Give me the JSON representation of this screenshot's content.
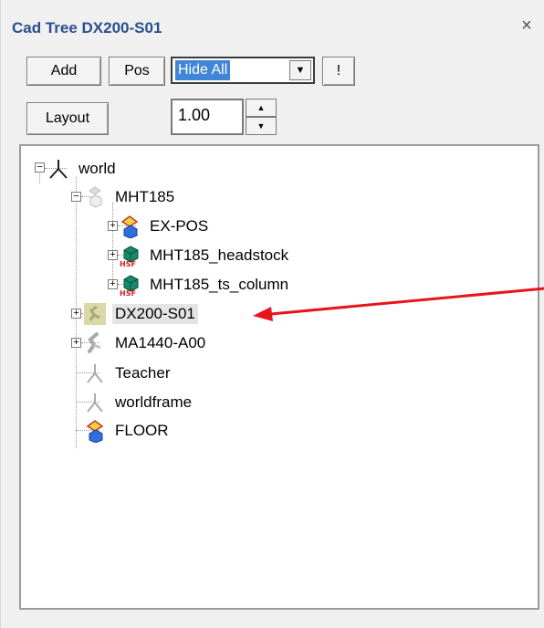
{
  "panel": {
    "title": "Cad Tree DX200-S01",
    "close_glyph": "×"
  },
  "toolbar": {
    "add_label": "Add",
    "pos_label": "Pos",
    "visibility_select": {
      "value": "Hide All",
      "arrow": "▼"
    },
    "bang_label": "!",
    "layout_label": "Layout",
    "scale_value": "1.00"
  },
  "tree": {
    "nodes": [
      {
        "label": "world",
        "icon": "robot-frame-icon",
        "expander": "−"
      },
      {
        "label": "MHT185",
        "icon": "gray-part-icon",
        "expander": "−"
      },
      {
        "label": "EX-POS",
        "icon": "cad-part-icon",
        "expander": "+"
      },
      {
        "label": "MHT185_headstock",
        "icon": "hsf-solid-icon",
        "expander": "+"
      },
      {
        "label": "MHT185_ts_column",
        "icon": "hsf-solid-icon",
        "expander": "+"
      },
      {
        "label": "DX200-S01",
        "icon": "controller-icon",
        "expander": "+",
        "selected": true
      },
      {
        "label": "MA1440-A00",
        "icon": "robot-arm-icon",
        "expander": "+"
      },
      {
        "label": "Teacher",
        "icon": "frame-icon"
      },
      {
        "label": "worldframe",
        "icon": "frame-icon"
      },
      {
        "label": "FLOOR",
        "icon": "cad-part-icon"
      }
    ]
  },
  "annotation": {
    "arrow_color": "#e8141c"
  }
}
